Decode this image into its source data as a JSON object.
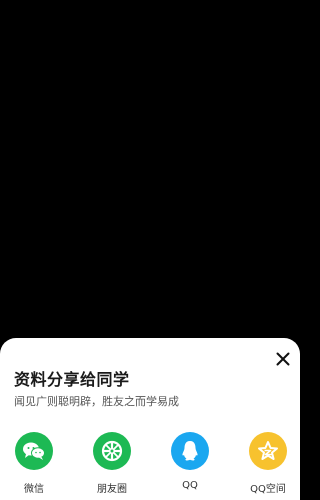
{
  "sheet": {
    "title": "资料分享给同学",
    "subtitle": "闻见广则聪明辟，胜友之而学易成"
  },
  "share_targets": [
    {
      "label": "微信",
      "icon": "wechat-icon",
      "color": "#1db954"
    },
    {
      "label": "朋友圈",
      "icon": "moments-icon",
      "color": "#1db954"
    },
    {
      "label": "QQ",
      "icon": "qq-icon",
      "color": "#1aa7f0"
    },
    {
      "label": "QQ空间",
      "icon": "qzone-icon",
      "color": "#f7c22e"
    }
  ]
}
